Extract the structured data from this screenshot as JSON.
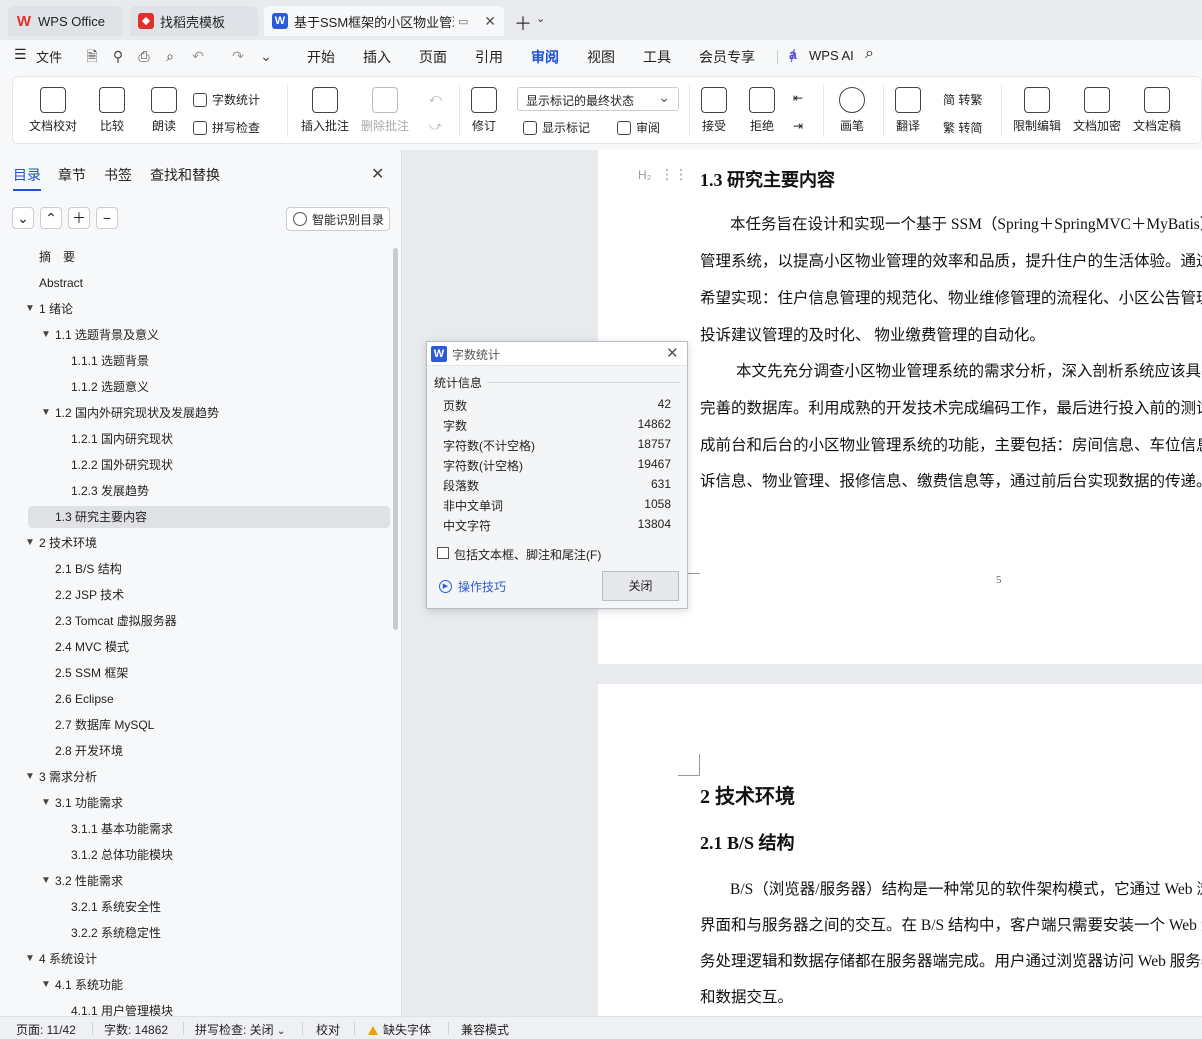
{
  "tabs": [
    {
      "label": "WPS Office",
      "icon": "wps-logo-icon"
    },
    {
      "label": "找稻壳模板",
      "icon": "docer-icon"
    },
    {
      "label": "基于SSM框架的小区物业管理",
      "icon": "word-doc-icon"
    }
  ],
  "menu": {
    "file": "文件",
    "items": [
      "开始",
      "插入",
      "页面",
      "引用",
      "审阅",
      "视图",
      "工具",
      "会员专享"
    ],
    "active": "审阅",
    "ai": "WPS AI"
  },
  "ribbon": {
    "doc_proofread": "文档校对",
    "compare": "比较",
    "read_aloud": "朗读",
    "word_count": "字数统计",
    "spell_check": "拼写检查",
    "insert_comment": "插入批注",
    "delete_comment": "删除批注",
    "track_changes": "修订",
    "markup_state": "显示标记的最终状态",
    "show_markup": "显示标记",
    "review_pane": "审阅",
    "accept": "接受",
    "reject": "拒绝",
    "pen": "画笔",
    "translate": "翻译",
    "to_traditional": "简 转繁",
    "to_simplified": "繁 转简",
    "restrict_edit": "限制编辑",
    "encrypt": "文档加密",
    "finalize": "文档定稿"
  },
  "nav": {
    "tabs": [
      "目录",
      "章节",
      "书签",
      "查找和替换"
    ],
    "active_tab": "目录",
    "smart_toc": "智能识别目录",
    "toc": [
      {
        "label": "摘　要",
        "level": 1,
        "caret": ""
      },
      {
        "label": "Abstract",
        "level": 1,
        "caret": ""
      },
      {
        "label": "1  绪论",
        "level": 1,
        "caret": "▼"
      },
      {
        "label": "1.1  选题背景及意义",
        "level": 2,
        "caret": "▼"
      },
      {
        "label": "1.1.1 选题背景",
        "level": 3,
        "caret": ""
      },
      {
        "label": "1.1.2 选题意义",
        "level": 3,
        "caret": ""
      },
      {
        "label": "1.2 国内外研究现状及发展趋势",
        "level": 2,
        "caret": "▼"
      },
      {
        "label": "1.2.1 国内研究现状",
        "level": 3,
        "caret": ""
      },
      {
        "label": "1.2.2 国外研究现状",
        "level": 3,
        "caret": ""
      },
      {
        "label": "1.2.3 发展趋势",
        "level": 3,
        "caret": ""
      },
      {
        "label": "1.3 研究主要内容",
        "level": 2,
        "caret": "",
        "selected": true
      },
      {
        "label": "2  技术环境",
        "level": 1,
        "caret": "▼"
      },
      {
        "label": "2.1 B/S 结构",
        "level": 2,
        "caret": ""
      },
      {
        "label": "2.2 JSP 技术",
        "level": 2,
        "caret": ""
      },
      {
        "label": "2.3 Tomcat 虚拟服务器",
        "level": 2,
        "caret": ""
      },
      {
        "label": "2.4 MVC 模式",
        "level": 2,
        "caret": ""
      },
      {
        "label": "2.5 SSM 框架",
        "level": 2,
        "caret": ""
      },
      {
        "label": "2.6 Eclipse",
        "level": 2,
        "caret": ""
      },
      {
        "label": "2.7 数据库  MySQL",
        "level": 2,
        "caret": ""
      },
      {
        "label": "2.8 开发环境",
        "level": 2,
        "caret": ""
      },
      {
        "label": "3  需求分析",
        "level": 1,
        "caret": "▼"
      },
      {
        "label": "3.1 功能需求",
        "level": 2,
        "caret": "▼"
      },
      {
        "label": "3.1.1  基本功能需求",
        "level": 3,
        "caret": ""
      },
      {
        "label": "3.1.2  总体功能模块",
        "level": 3,
        "caret": ""
      },
      {
        "label": "3.2 性能需求",
        "level": 2,
        "caret": "▼"
      },
      {
        "label": "3.2.1 系统安全性",
        "level": 3,
        "caret": ""
      },
      {
        "label": "3.2.2 系统稳定性",
        "level": 3,
        "caret": ""
      },
      {
        "label": "4  系统设计",
        "level": 1,
        "caret": "▼"
      },
      {
        "label": "4.1 系统功能",
        "level": 2,
        "caret": "▼"
      },
      {
        "label": "4.1.1 用户管理模块",
        "level": 3,
        "caret": ""
      }
    ]
  },
  "document": {
    "heading_marker": "H₂",
    "page1": {
      "heading": "1.3 研究主要内容",
      "lines": [
        "本任务旨在设计和实现一个基于 SSM（Spring＋SpringMVC＋MyBatis）框",
        "管理系统，以提高小区物业管理的效率和品质，提升住户的生活体验。通过本",
        "希望实现：住户信息管理的规范化、物业维修管理的流程化、小区公告管理的",
        "投诉建议管理的及时化、 物业缴费管理的自动化。",
        "本文先充分调查小区物业管理系统的需求分析，深入剖析系统应该具有的",
        "完善的数据库。利用成熟的开发技术完成编码工作，最后进行投入前的测试工",
        "成前台和后台的小区物业管理系统的功能，主要包括：房间信息、车位信息、",
        "诉信息、物业管理、报修信息、缴费信息等，通过前后台实现数据的传递。"
      ],
      "page_number": "5"
    },
    "page2": {
      "chapter": "2  技术环境",
      "heading": "2.1 B/S 结构",
      "lines": [
        "B/S（浏览器/服务器）结构是一种常见的软件架构模式，它通过 Web 浏览",
        "界面和与服务器之间的交互。在 B/S 结构中，客户端只需要安装一个 Web 浏览",
        "务处理逻辑和数据存储都在服务器端完成。用户通过浏览器访问 Web 服务器，",
        "和数据交互。"
      ]
    }
  },
  "dialog": {
    "title": "字数统计",
    "section": "统计信息",
    "stats": [
      {
        "label": "页数",
        "value": "42"
      },
      {
        "label": "字数",
        "value": "14862"
      },
      {
        "label": "字符数(不计空格)",
        "value": "18757"
      },
      {
        "label": "字符数(计空格)",
        "value": "19467"
      },
      {
        "label": "段落数",
        "value": "631"
      },
      {
        "label": "非中文单词",
        "value": "1058"
      },
      {
        "label": "中文字符",
        "value": "13804"
      }
    ],
    "include_label": "包括文本框、脚注和尾注(F)",
    "include_checked": false,
    "tips": "操作技巧",
    "close": "关闭"
  },
  "status": {
    "page": "页面: 11/42",
    "words": "字数: 14862",
    "spell": "拼写检查: 关闭",
    "proof": "校对",
    "missing_font": "缺失字体",
    "compat": "兼容模式"
  },
  "colors": {
    "accent": "#1f4fd8",
    "wps_red": "#e0322a",
    "word_blue": "#2b5cd6"
  }
}
